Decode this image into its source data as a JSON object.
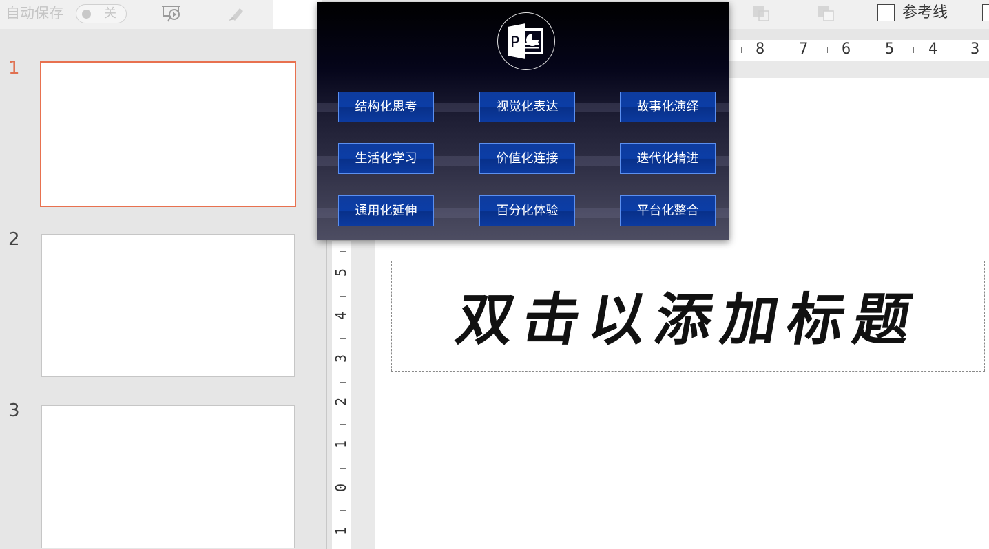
{
  "toolbar": {
    "autosave_label": "自动保存",
    "autosave_state": "关",
    "guides_label": "参考线",
    "guides_checked": false
  },
  "thumbnails": [
    {
      "number": "1",
      "selected": true
    },
    {
      "number": "2",
      "selected": false
    },
    {
      "number": "3",
      "selected": false
    }
  ],
  "ruler": {
    "horizontal": [
      "8",
      "7",
      "6",
      "5",
      "4",
      "3"
    ],
    "vertical": [
      "5",
      "4",
      "3",
      "2",
      "1",
      "0",
      "1"
    ]
  },
  "slide": {
    "title_placeholder": "双击以添加标题"
  },
  "popup": {
    "logo_icon": "powerpoint-logo-icon",
    "buttons": [
      [
        "结构化思考",
        "视觉化表达",
        "故事化演绎"
      ],
      [
        "生活化学习",
        "价值化连接",
        "迭代化精进"
      ],
      [
        "通用化延伸",
        "百分化体验",
        "平台化整合"
      ]
    ]
  },
  "colors": {
    "selection_accent": "#e8714f",
    "popup_button": "#0b3da6",
    "popup_button_border": "#5b8ff0"
  }
}
